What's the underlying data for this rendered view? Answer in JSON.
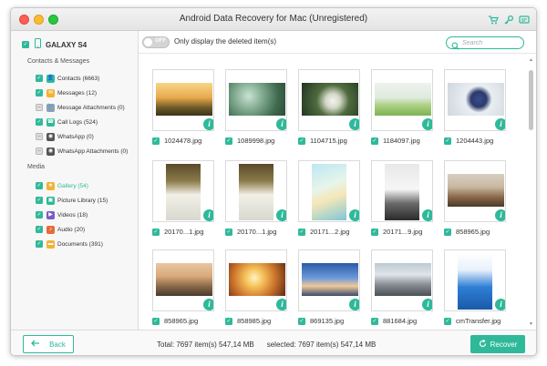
{
  "window": {
    "title": "Android Data Recovery for Mac (Unregistered)"
  },
  "titlebar_icons": [
    "cart-icon",
    "key-icon",
    "feedback-icon"
  ],
  "sidebar": {
    "device": "GALAXY S4",
    "sections": [
      {
        "label": "Contacts & Messages",
        "items": [
          {
            "label": "Contacts (6663)",
            "icon": "contacts-icon",
            "color": "#2fb99a",
            "checked": "full"
          },
          {
            "label": "Messages (12)",
            "icon": "messages-icon",
            "color": "#f2b233",
            "checked": "full"
          },
          {
            "label": "Message Attachments (0)",
            "icon": "attachment-icon",
            "color": "#8aa0b8",
            "checked": "partial"
          },
          {
            "label": "Call Logs (524)",
            "icon": "phone-icon",
            "color": "#2fb99a",
            "checked": "full"
          },
          {
            "label": "WhatsApp (0)",
            "icon": "whatsapp-icon",
            "color": "#555555",
            "checked": "partial"
          },
          {
            "label": "WhatsApp Attachments (0)",
            "icon": "whatsapp-attachment-icon",
            "color": "#555555",
            "checked": "partial"
          }
        ]
      },
      {
        "label": "Media",
        "items": [
          {
            "label": "Gallery (54)",
            "icon": "gallery-icon",
            "color": "#f2b233",
            "checked": "full",
            "active": true
          },
          {
            "label": "Picture Library (15)",
            "icon": "picture-icon",
            "color": "#2fb99a",
            "checked": "full"
          },
          {
            "label": "Videos (18)",
            "icon": "video-icon",
            "color": "#7a5cc9",
            "checked": "full"
          },
          {
            "label": "Audio (20)",
            "icon": "audio-icon",
            "color": "#e86a3a",
            "checked": "full"
          },
          {
            "label": "Documents (391)",
            "icon": "folder-icon",
            "color": "#f2b233",
            "checked": "full"
          }
        ]
      }
    ]
  },
  "toolbar": {
    "toggle_label": "OFF",
    "only_deleted": "Only display the deleted item(s)",
    "search_placeholder": "Search"
  },
  "files": [
    {
      "name": "1024478.jpg",
      "art": "sunset-field",
      "orient": "wide"
    },
    {
      "name": "1089998.jpg",
      "art": "green-leaves",
      "orient": "wide"
    },
    {
      "name": "1104715.jpg",
      "art": "white-flowers",
      "orient": "wide"
    },
    {
      "name": "1184097.jpg",
      "art": "meadow",
      "orient": "wide"
    },
    {
      "name": "1204443.jpg",
      "art": "blueberries",
      "orient": "wide"
    },
    {
      "name": "20170...1.jpg",
      "art": "phone-photo",
      "orient": "tall"
    },
    {
      "name": "20170...1.jpg",
      "art": "phone-photo",
      "orient": "tall"
    },
    {
      "name": "20171...2.jpg",
      "art": "photo-on-desk",
      "orient": "tall"
    },
    {
      "name": "20171...9.jpg",
      "art": "screen-photo",
      "orient": "tall"
    },
    {
      "name": "858965.jpg",
      "art": "landscape-dusk",
      "orient": "wide"
    },
    {
      "name": "858965.jpg",
      "art": "road-sunset",
      "orient": "wide"
    },
    {
      "name": "858985.jpg",
      "art": "sun-flare",
      "orient": "wide"
    },
    {
      "name": "869135.jpg",
      "art": "blue-sky",
      "orient": "wide"
    },
    {
      "name": "881684.jpg",
      "art": "street",
      "orient": "wide"
    },
    {
      "name": "cmTransfer.jpg",
      "art": "app-poster",
      "orient": "tall"
    }
  ],
  "footer": {
    "back_label": "Back",
    "total": "Total: 7697 item(s) 547,14 MB",
    "selected": "selected: 7697 item(s) 547,14 MB",
    "recover_label": "Recover"
  },
  "colors": {
    "accent": "#2fb99a"
  }
}
